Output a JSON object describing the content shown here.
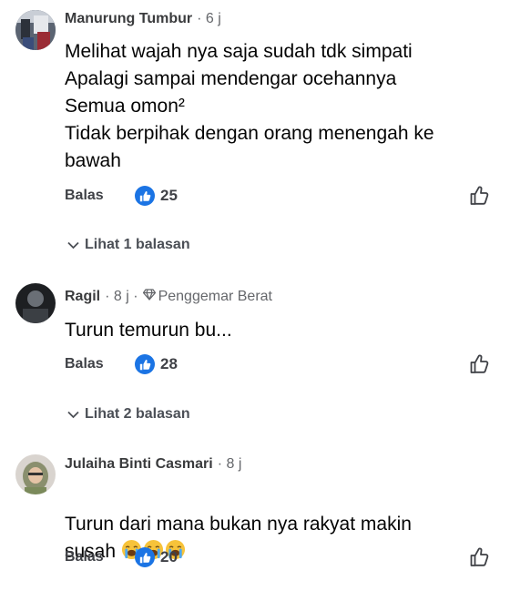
{
  "comments": [
    {
      "author": "Manurung Tumbur",
      "meta": "· 6 j",
      "body": "Melihat wajah nya saja sudah tdk simpati\nApalagi sampai mendengar ocehannya\nSemua omon²\nTidak berpihak dengan orang menengah ke\nbawah",
      "reply_label": "Balas",
      "likes": "25",
      "view_replies": "Lihat 1 balasan"
    },
    {
      "author": "Ragil",
      "meta": "· 8 j ·",
      "badge": "Penggemar Berat",
      "body": "Turun temurun bu...",
      "reply_label": "Balas",
      "likes": "28",
      "view_replies": "Lihat 2 balasan"
    },
    {
      "author": "Julaiha Binti Casmari",
      "meta": "· 8 j",
      "body": "Turun dari mana bukan nya rakyat makin\nsusah",
      "emojis": [
        "loudly-crying-face",
        "loudly-crying-face",
        "loudly-crying-face"
      ],
      "reply_label": "Balas",
      "likes": "20"
    }
  ],
  "colors": {
    "like_blue": "#1b74e4",
    "meta_gray": "#65676b",
    "text": "#050505"
  },
  "icons": {
    "like_badge": "thumbs-up-icon",
    "like_button": "thumbs-up-outline-icon",
    "fan_badge": "diamond-icon",
    "expand": "chevron-down-icon"
  }
}
